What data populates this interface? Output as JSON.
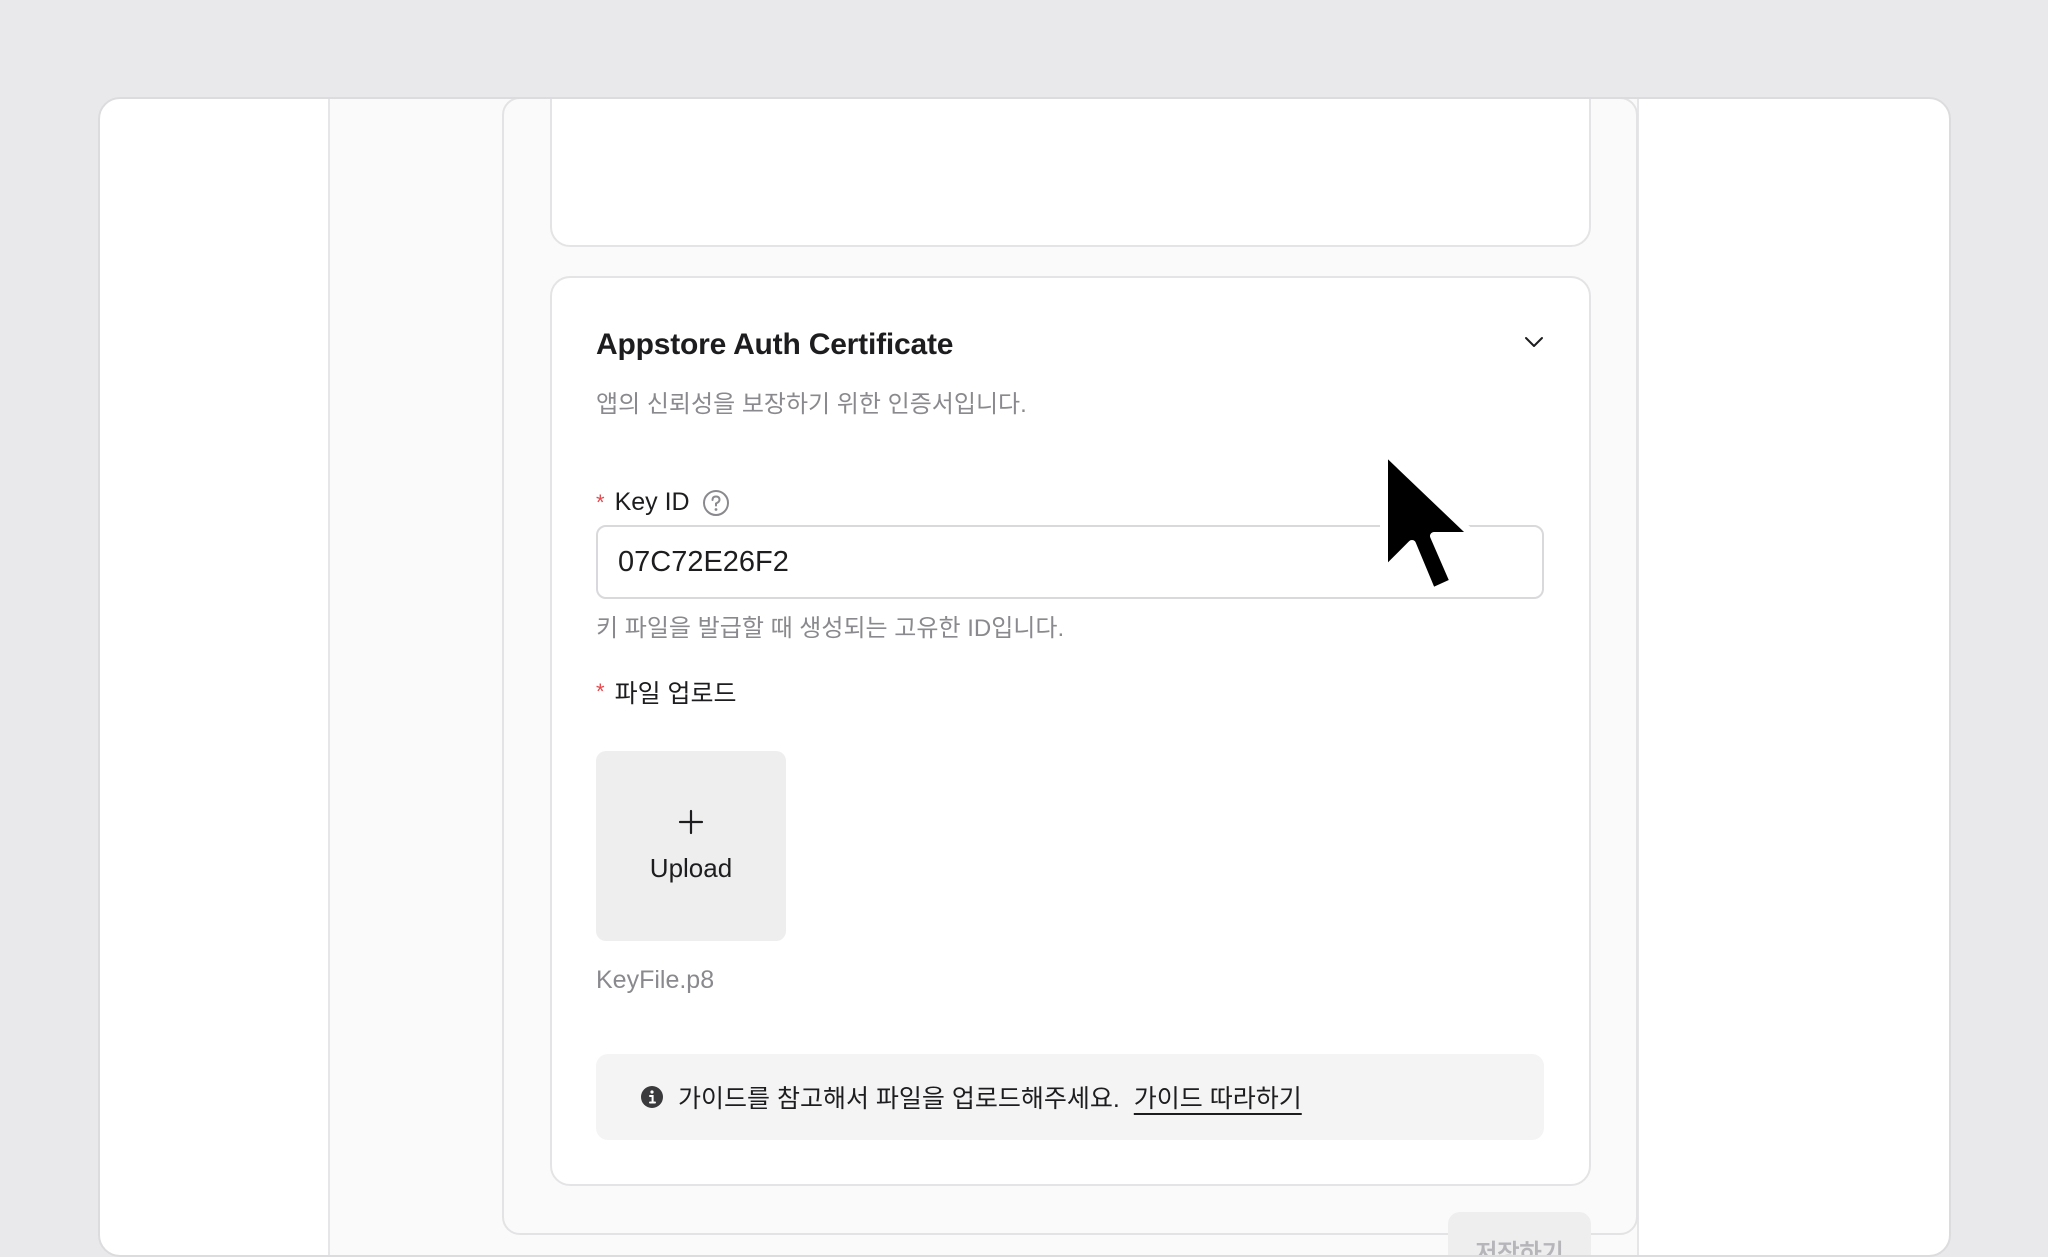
{
  "card": {
    "title": "Appstore Auth Certificate",
    "description": "앱의 신뢰성을 보장하기 위한 인증서입니다."
  },
  "key_id": {
    "required_mark": "*",
    "label": "Key ID",
    "value": "07C72E26F2",
    "hint": "키 파일을 발급할 때 생성되는 고유한 ID입니다."
  },
  "file_upload": {
    "required_mark": "*",
    "label": "파일 업로드",
    "upload_label": "Upload",
    "file_name": "KeyFile.p8"
  },
  "guide": {
    "text": "가이드를 참고해서 파일을 업로드해주세요.",
    "link": "가이드 따라하기"
  },
  "save_button": "저장하기",
  "colors": {
    "required": "#e5484d",
    "disabled_text": "#b6b6ba",
    "muted_text": "#8a8a8e"
  },
  "icons": {
    "collapse": "chevron-down-icon",
    "help": "question-circle-icon",
    "upload": "plus-icon",
    "info": "info-circle-icon"
  }
}
